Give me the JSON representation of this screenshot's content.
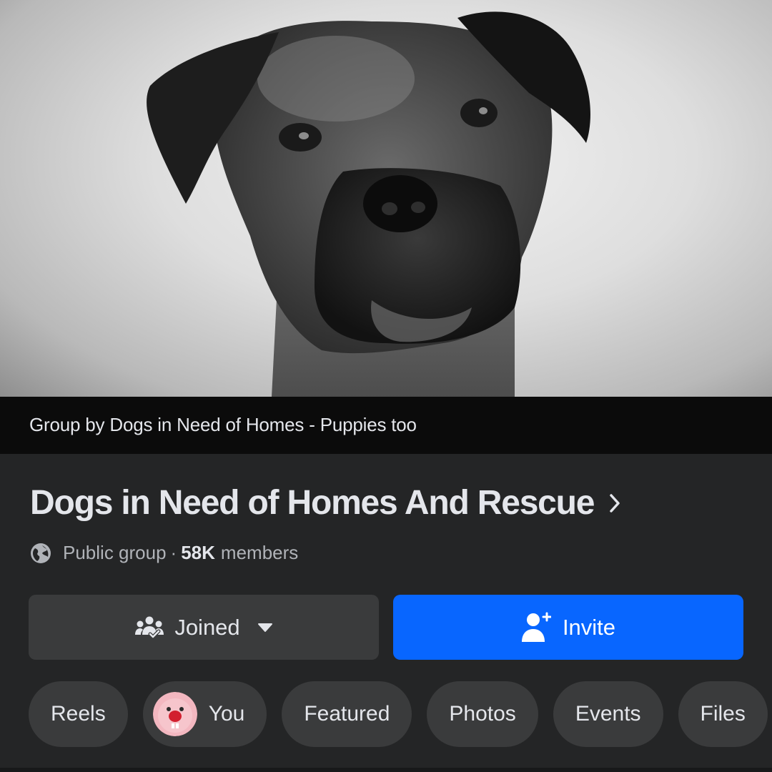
{
  "cover": {
    "image_description": "Black and white portrait of a sad dog",
    "caption": "Group by Dogs in Need of Homes - Puppies too"
  },
  "group": {
    "name": "Dogs in Need of Homes And Rescue",
    "privacy": "Public group",
    "separator": "·",
    "member_count": "58K",
    "member_label": "members"
  },
  "actions": {
    "joined_label": "Joined",
    "invite_label": "Invite"
  },
  "tabs": [
    {
      "label": "Reels"
    },
    {
      "label": "You"
    },
    {
      "label": "Featured"
    },
    {
      "label": "Photos"
    },
    {
      "label": "Events"
    },
    {
      "label": "Files"
    }
  ],
  "icons": {
    "privacy_icon": "globe-icon",
    "title_icon": "chevron-right-icon",
    "joined_icon": "group-members-icon",
    "joined_caret": "caret-down-icon",
    "invite_icon": "add-person-icon"
  },
  "colors": {
    "background": "#242526",
    "caption_bar": "#0b0b0b",
    "secondary_button": "#3a3b3c",
    "primary_button": "#0866ff",
    "primary_text": "#e4e6eb",
    "secondary_text": "#b0b3b8"
  }
}
